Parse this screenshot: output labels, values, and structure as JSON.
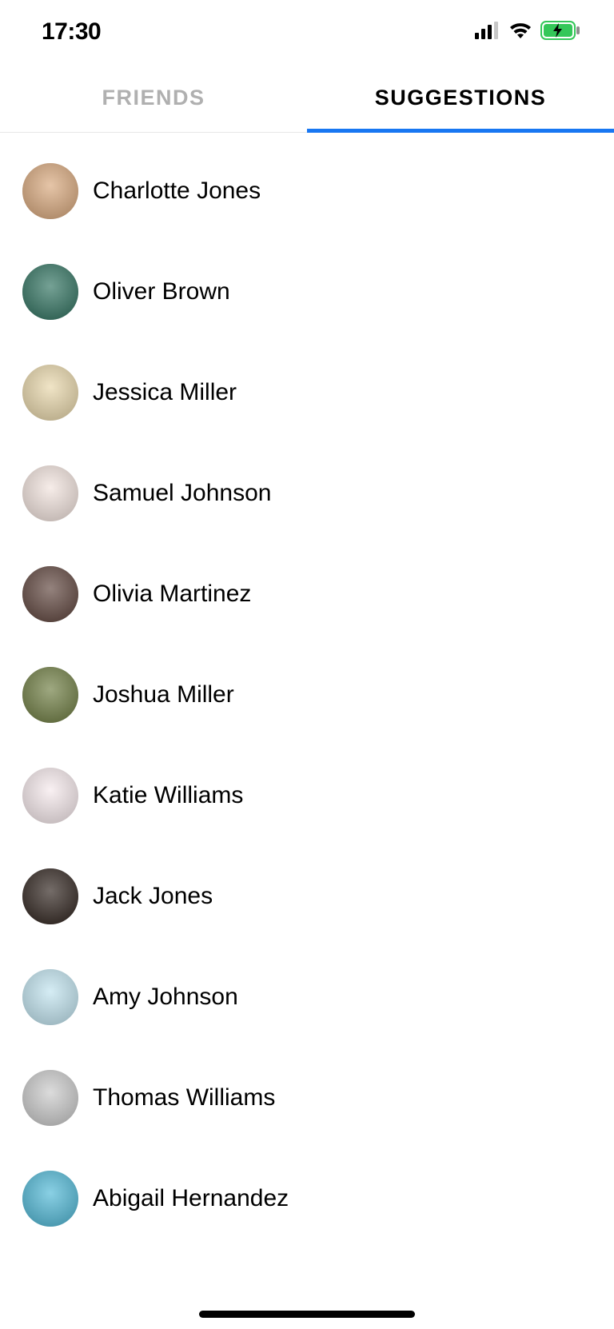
{
  "status": {
    "time": "17:30"
  },
  "tabs": {
    "friends": {
      "label": "FRIENDS",
      "active": false
    },
    "suggestions": {
      "label": "SUGGESTIONS",
      "active": true
    }
  },
  "suggestions": [
    {
      "name": "Charlotte Jones",
      "avatar_bg": "#d8a679"
    },
    {
      "name": "Oliver Brown",
      "avatar_bg": "#2b6f5c"
    },
    {
      "name": "Jessica Miller",
      "avatar_bg": "#e8d6a8"
    },
    {
      "name": "Samuel Johnson",
      "avatar_bg": "#f2e3dd"
    },
    {
      "name": "Olivia Martinez",
      "avatar_bg": "#5b4038"
    },
    {
      "name": "Joshua Miller",
      "avatar_bg": "#6b7a3d"
    },
    {
      "name": "Katie Williams",
      "avatar_bg": "#f6e9ec"
    },
    {
      "name": "Jack Jones",
      "avatar_bg": "#2a1e18"
    },
    {
      "name": "Amy Johnson",
      "avatar_bg": "#bfe3ef"
    },
    {
      "name": "Thomas Williams",
      "avatar_bg": "#c9c9c9"
    },
    {
      "name": "Abigail Hernandez",
      "avatar_bg": "#4bb7d6"
    }
  ]
}
